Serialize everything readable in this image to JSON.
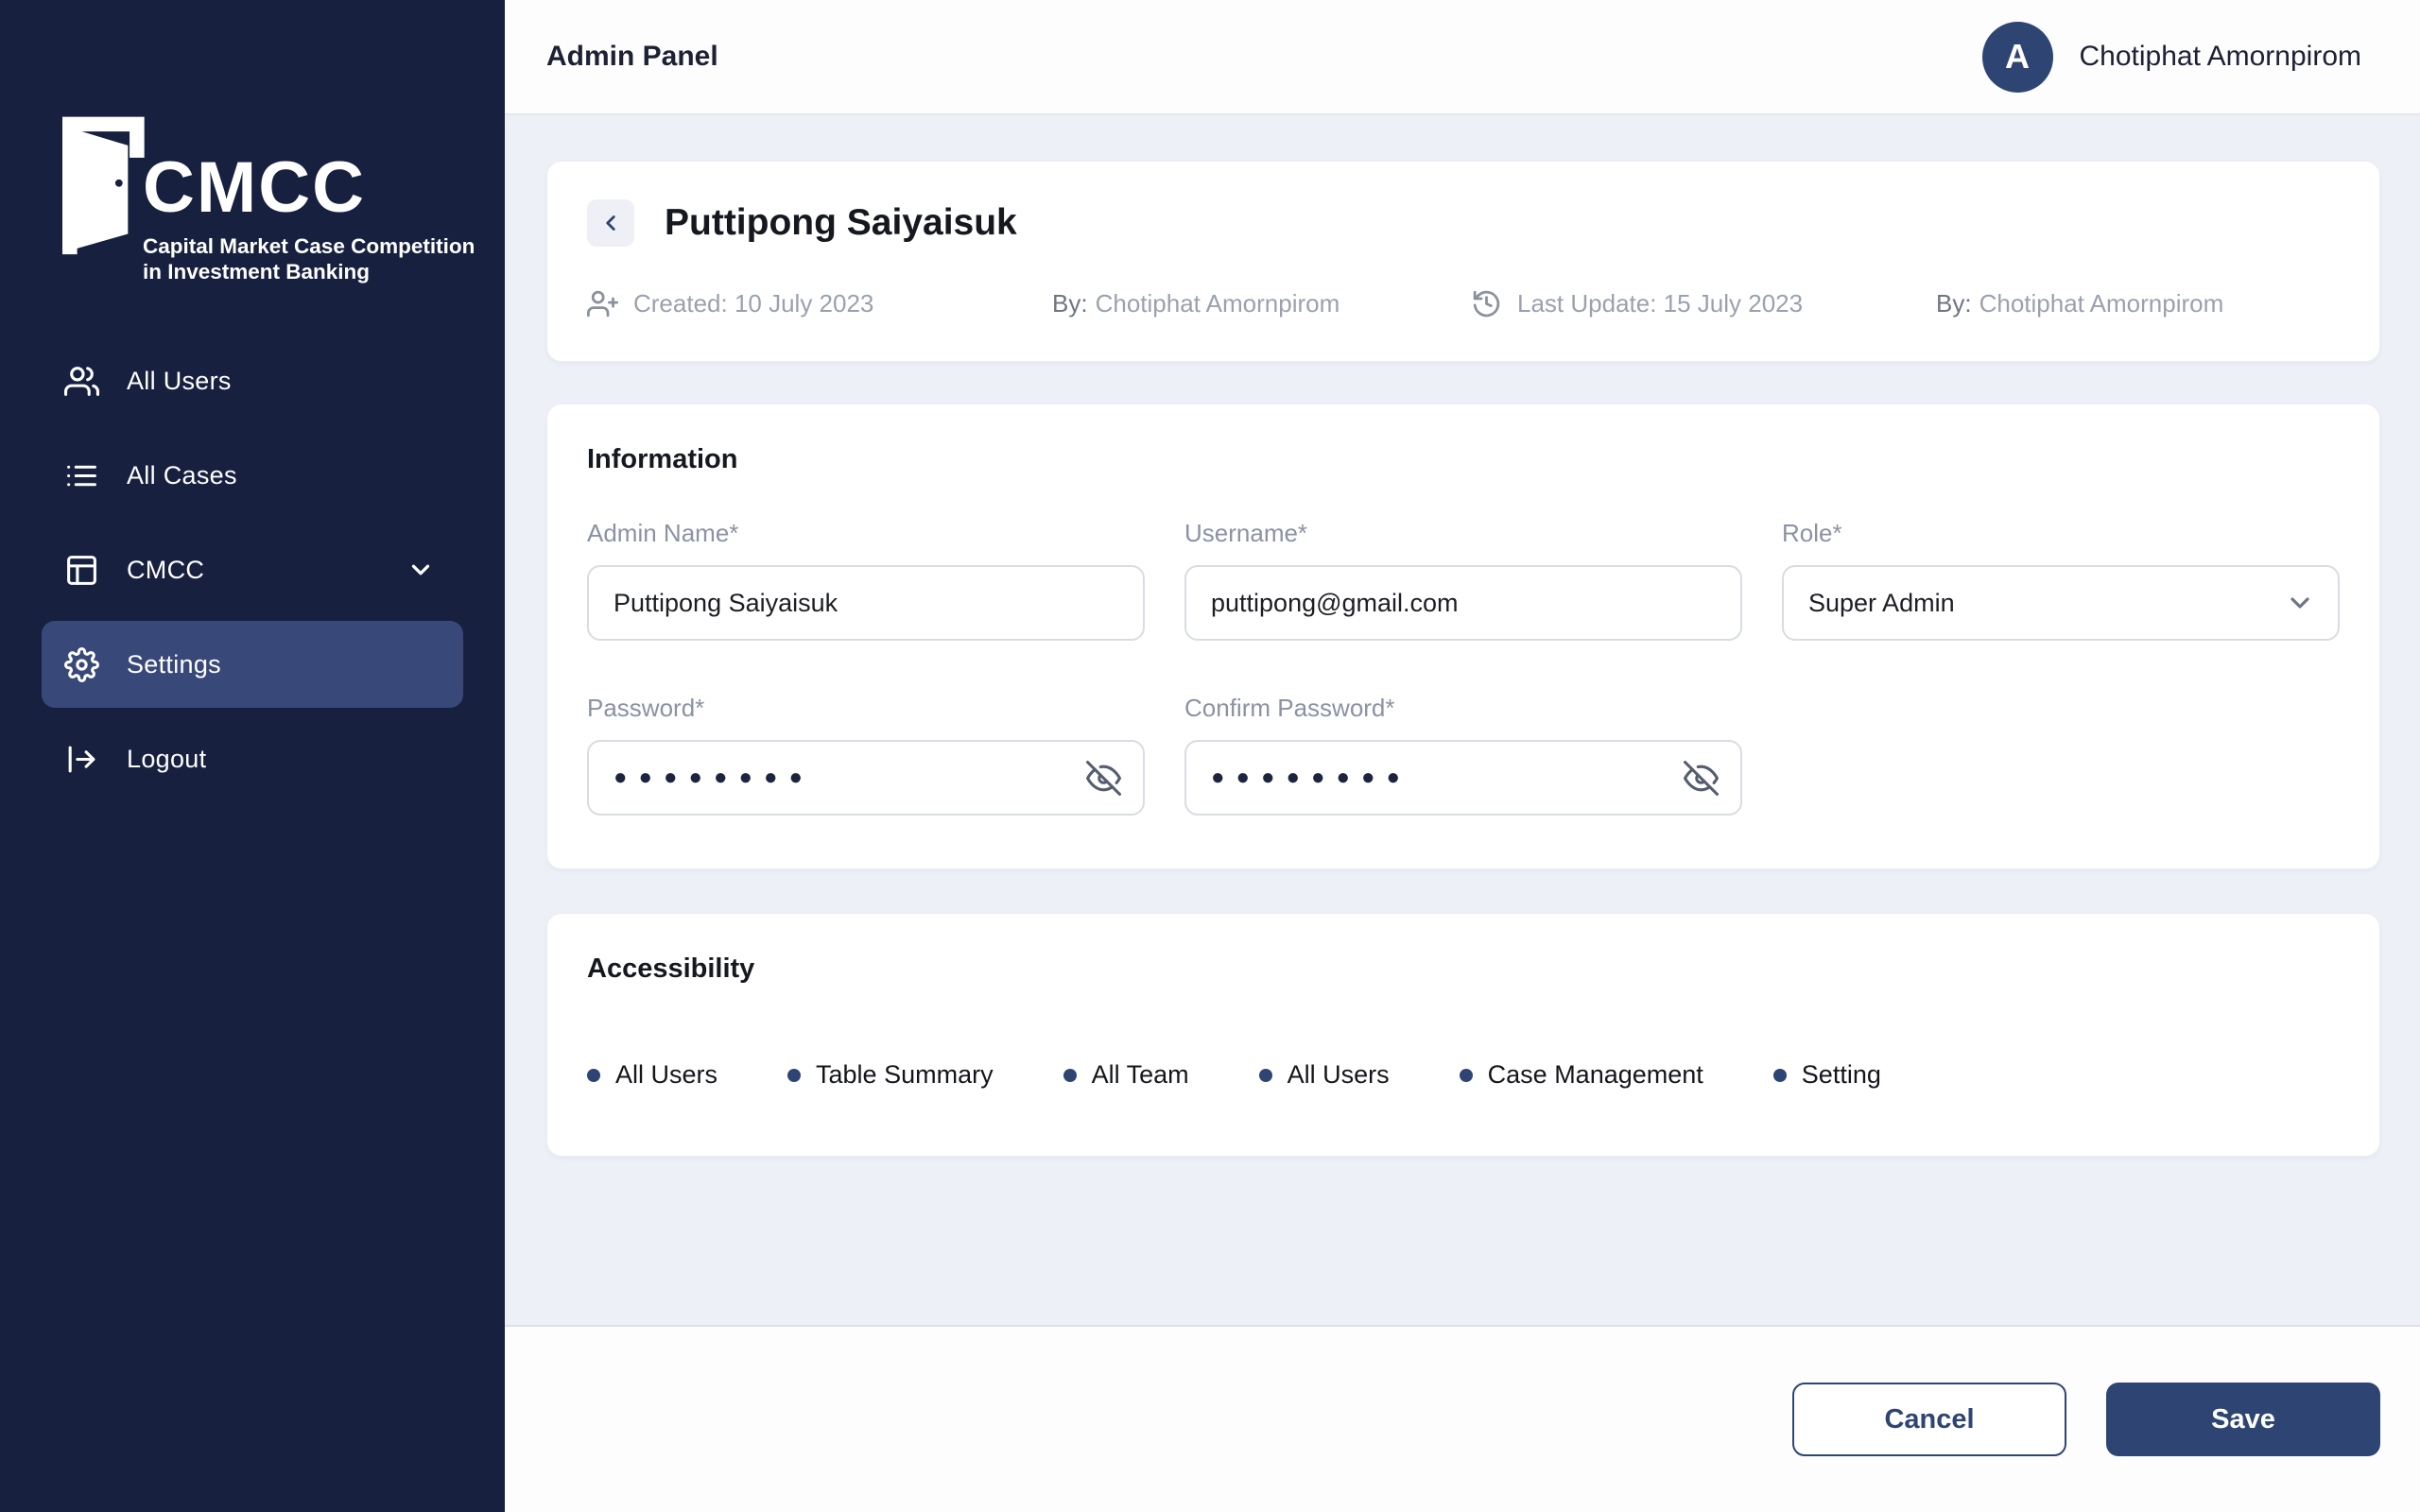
{
  "app": {
    "title": "Admin Panel"
  },
  "user": {
    "initial": "A",
    "name": "Chotiphat Amornpirom"
  },
  "sidebar": {
    "logo": {
      "acronym": "CMCC",
      "tagline_line1": "Capital Market Case Competition",
      "tagline_line2": "in Investment Banking"
    },
    "items": [
      {
        "label": "All Users",
        "icon": "users-icon",
        "active": false
      },
      {
        "label": "All Cases",
        "icon": "list-icon",
        "active": false
      },
      {
        "label": "CMCC",
        "icon": "layout-icon",
        "active": false,
        "has_chevron": true
      },
      {
        "label": "Settings",
        "icon": "gear-icon",
        "active": true
      },
      {
        "label": "Logout",
        "icon": "logout-icon",
        "active": false
      }
    ]
  },
  "record_header": {
    "title": "Puttipong Saiyaisuk",
    "created_label": "Created: 10 July 2023",
    "created_by_label": "By:",
    "created_by": "Chotiphat Amornpirom",
    "updated_label": "Last Update: 15 July 2023",
    "updated_by_label": "By:",
    "updated_by": "Chotiphat Amornpirom"
  },
  "information": {
    "section_title": "Information",
    "fields": {
      "admin_name": {
        "label": "Admin Name*",
        "value": "Puttipong Saiyaisuk"
      },
      "username": {
        "label": "Username*",
        "value": "puttipong@gmail.com"
      },
      "role": {
        "label": "Role*",
        "value": "Super Admin"
      },
      "password": {
        "label": "Password*",
        "masked_value": "●●●●●●●●"
      },
      "confirm_password": {
        "label": "Confirm Password*",
        "masked_value": "●●●●●●●●"
      }
    }
  },
  "accessibility": {
    "section_title": "Accessibility",
    "items": [
      "All Users",
      "Table Summary",
      "All Team",
      "All Users",
      "Case Management",
      "Setting"
    ]
  },
  "footer": {
    "cancel_label": "Cancel",
    "save_label": "Save"
  },
  "colors": {
    "sidebar_bg": "#17213F",
    "active_item_bg": "#384878",
    "accent": "#2E4573",
    "content_bg": "#EEF0F8"
  }
}
